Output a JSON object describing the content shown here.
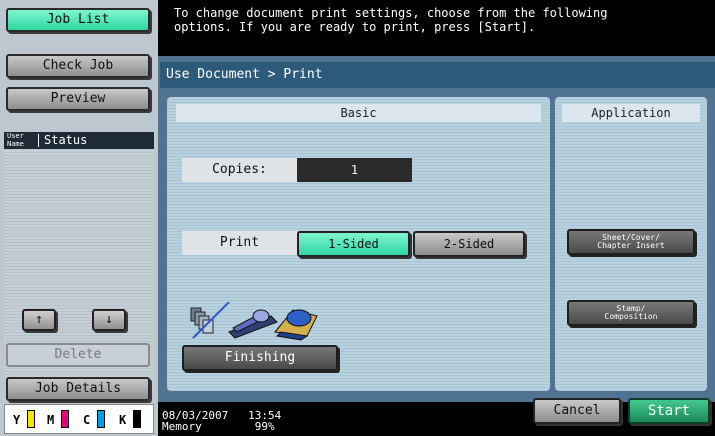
{
  "left": {
    "job_list": "Job List",
    "check_job": "Check Job",
    "preview": "Preview",
    "user_name": "User\nName",
    "status": "Status",
    "up_arrow": "↑",
    "down_arrow": "↓",
    "delete": "Delete",
    "job_details": "Job Details",
    "toner": [
      "Y",
      "M",
      "C",
      "K"
    ]
  },
  "message": "To change document print settings, choose from the following\noptions. If you are ready to print, press [Start].",
  "title": "Use Document > Print",
  "basic": {
    "heading": "Basic",
    "copies_label": "Copies:",
    "copies_value": "1",
    "print_label": "Print",
    "one_sided": "1-Sided",
    "two_sided": "2-Sided",
    "finishing": "Finishing"
  },
  "application": {
    "heading": "Application",
    "sheet_cover": "Sheet/Cover/\nChapter Insert",
    "stamp": "Stamp/\nComposition"
  },
  "status_bar": {
    "date": "08/03/2007",
    "time": "13:54",
    "memory_label": "Memory",
    "memory_value": "99%"
  },
  "actions": {
    "cancel": "Cancel",
    "start": "Start"
  },
  "colors": {
    "accent_selected": "#2fd7a2",
    "start_green": "#1b8a5a",
    "title_blue": "#2d5a7a"
  }
}
